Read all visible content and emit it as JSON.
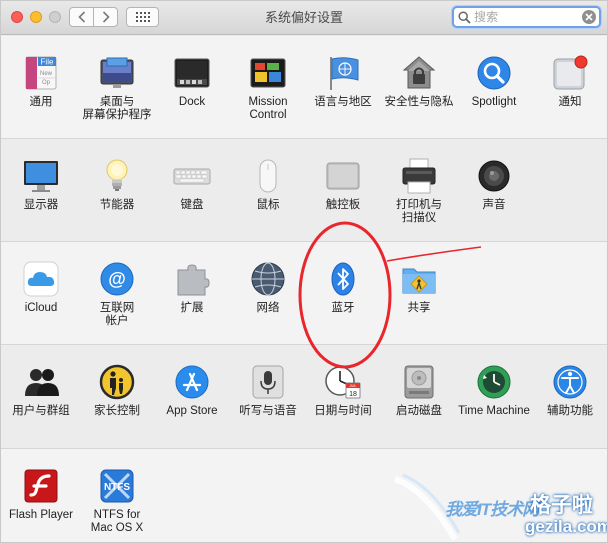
{
  "window": {
    "title": "系统偏好设置"
  },
  "search": {
    "placeholder": "搜索",
    "value": ""
  },
  "sections": [
    {
      "panes": [
        {
          "label": "通用",
          "icon": "general-icon"
        },
        {
          "label": "桌面与\n屏幕保护程序",
          "icon": "desktop-screensaver-icon"
        },
        {
          "label": "Dock",
          "icon": "dock-icon"
        },
        {
          "label": "Mission\nControl",
          "icon": "mission-control-icon"
        },
        {
          "label": "语言与地区",
          "icon": "language-region-icon"
        },
        {
          "label": "安全性与隐私",
          "icon": "security-privacy-icon"
        },
        {
          "label": "Spotlight",
          "icon": "spotlight-icon"
        },
        {
          "label": "通知",
          "icon": "notifications-icon"
        }
      ]
    },
    {
      "panes": [
        {
          "label": "显示器",
          "icon": "displays-icon"
        },
        {
          "label": "节能器",
          "icon": "energy-saver-icon"
        },
        {
          "label": "键盘",
          "icon": "keyboard-icon"
        },
        {
          "label": "鼠标",
          "icon": "mouse-icon"
        },
        {
          "label": "触控板",
          "icon": "trackpad-icon"
        },
        {
          "label": "打印机与\n扫描仪",
          "icon": "printer-scanner-icon"
        },
        {
          "label": "声音",
          "icon": "sound-icon"
        }
      ]
    },
    {
      "panes": [
        {
          "label": "iCloud",
          "icon": "icloud-icon"
        },
        {
          "label": "互联网\n帐户",
          "icon": "internet-accounts-icon"
        },
        {
          "label": "扩展",
          "icon": "extensions-icon"
        },
        {
          "label": "网络",
          "icon": "network-icon"
        },
        {
          "label": "蓝牙",
          "icon": "bluetooth-icon"
        },
        {
          "label": "共享",
          "icon": "sharing-icon"
        }
      ]
    },
    {
      "panes": [
        {
          "label": "用户与群组",
          "icon": "users-groups-icon"
        },
        {
          "label": "家长控制",
          "icon": "parental-controls-icon"
        },
        {
          "label": "App Store",
          "icon": "app-store-icon"
        },
        {
          "label": "听写与语音",
          "icon": "dictation-speech-icon"
        },
        {
          "label": "日期与时间",
          "icon": "date-time-icon"
        },
        {
          "label": "启动磁盘",
          "icon": "startup-disk-icon"
        },
        {
          "label": "Time Machine",
          "icon": "time-machine-icon"
        },
        {
          "label": "辅助功能",
          "icon": "accessibility-icon"
        }
      ]
    },
    {
      "panes": [
        {
          "label": "Flash Player",
          "icon": "flash-player-icon"
        },
        {
          "label": "NTFS for\nMac OS X",
          "icon": "ntfs-icon"
        }
      ]
    }
  ],
  "icon_text": {
    "general_tab": "File",
    "general_sub": "New",
    "general_sub2": "Op",
    "calendar_month": "JUL",
    "calendar_day": "18",
    "ntfs": "NTFS"
  },
  "watermark": {
    "cn": "我爱IT技术网",
    "brand": "格子啦",
    "domain": "gezila.com"
  },
  "colors": {
    "annotation": "#e8262c",
    "search_focus": "#6ea1e6",
    "accent_blue": "#1a7cf0"
  }
}
